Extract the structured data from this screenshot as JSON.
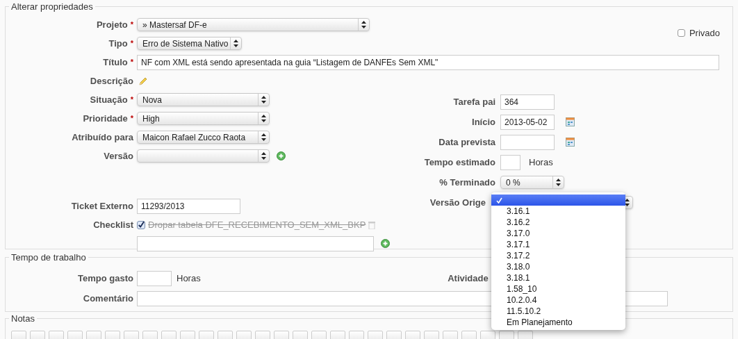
{
  "required_mark": "*",
  "properties": {
    "legend": "Alterar propriedades",
    "private": {
      "label": "Privado",
      "checked": false
    },
    "top_fields": [
      {
        "label": "Projeto",
        "required": true,
        "kind": "select",
        "value": "» Mastersaf DF-e"
      },
      {
        "label": "Tipo",
        "required": true,
        "kind": "select",
        "value": "Erro de Sistema Nativo"
      },
      {
        "label": "Título",
        "required": true,
        "kind": "text",
        "value": "NF com XML está sendo apresentada na guia “Listagem de DANFEs Sem XML\""
      },
      {
        "label": "Descrição",
        "required": false,
        "kind": "edit"
      }
    ],
    "left_fields": [
      {
        "label": "Situação",
        "required": true,
        "kind": "select",
        "value": "Nova"
      },
      {
        "label": "Prioridade",
        "required": true,
        "kind": "select",
        "value": "High"
      },
      {
        "label": "Atribuído para",
        "required": false,
        "kind": "select",
        "value": "Maicon Rafael Zucco Raota"
      },
      {
        "label": "Versão",
        "required": false,
        "kind": "select",
        "add": true
      },
      {
        "kind": "spacer"
      },
      {
        "label": "Ticket Externo",
        "required": false,
        "kind": "text",
        "value": "11293/2013"
      },
      {
        "label": "Checklist",
        "required": false,
        "kind": "checklist",
        "items": [
          {
            "text": "Dropar tabela DFE_RECEBIMENTO_SEM_XML_BKP",
            "checked": true
          }
        ]
      },
      {
        "kind": "new_item"
      }
    ],
    "right_fields": [
      {
        "label": "Tarefa pai",
        "kind": "text",
        "value": "364"
      },
      {
        "label": "Início",
        "kind": "date",
        "value": "2013-05-02"
      },
      {
        "label": "Data prevista",
        "kind": "date"
      },
      {
        "label": "Tempo estimado",
        "kind": "hours",
        "unit": "Horas"
      },
      {
        "label": "% Terminado",
        "kind": "select",
        "value": "0 %"
      },
      {
        "label": "Versão Orige",
        "kind": "open_select",
        "options": [
          {
            "selected": true
          },
          {
            "label": "3.16.1",
            "selected": false
          },
          {
            "label": "3.16.2",
            "selected": false
          },
          {
            "label": "3.17.0",
            "selected": false
          },
          {
            "label": "3.17.1",
            "selected": false
          },
          {
            "label": "3.17.2",
            "selected": false
          },
          {
            "label": "3.18.0",
            "selected": false
          },
          {
            "label": "3.18.1",
            "selected": false
          },
          {
            "label": "1.58_10",
            "selected": false
          },
          {
            "label": "10.2.0.4",
            "selected": false
          },
          {
            "label": "11.5.10.2",
            "selected": false
          },
          {
            "label": "Em Planejamento",
            "selected": false
          }
        ]
      }
    ]
  },
  "time": {
    "legend": "Tempo de trabalho",
    "spent_label": "Tempo gasto",
    "unit": "Horas",
    "activity_label": "Atividade",
    "comment_label": "Comentário"
  },
  "notes": {
    "legend": "Notas"
  }
}
